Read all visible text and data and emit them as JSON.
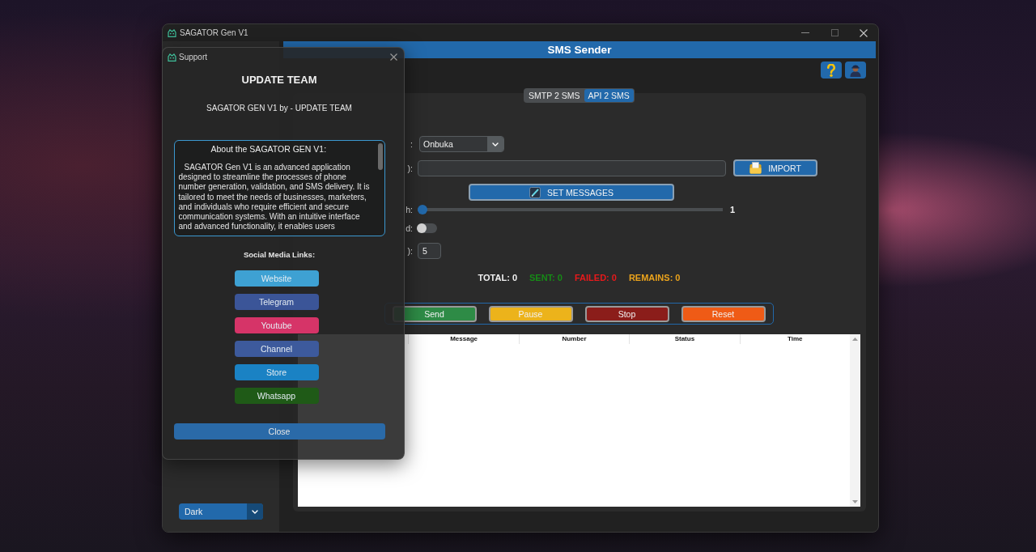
{
  "window": {
    "title": "SAGATOR Gen V1"
  },
  "sidebar": {
    "appearance_mode": {
      "value": "Dark"
    }
  },
  "header": {
    "title": "SMS Sender"
  },
  "tabs": [
    {
      "label": "SMTP 2 SMS",
      "selected": false
    },
    {
      "label": "API 2 SMS",
      "selected": true
    }
  ],
  "form": {
    "provider": {
      "label": ":",
      "value": "Onbuka"
    },
    "recipients": {
      "label": "):",
      "button": "IMPORT"
    },
    "set_messages_button": "SET MESSAGES",
    "batch": {
      "label": "h:",
      "level": 0,
      "reading": "1"
    },
    "thread": {
      "label": "d:",
      "on": false
    },
    "interval": {
      "label": "):",
      "value": "5"
    }
  },
  "stats": [
    {
      "label": "TOTAL: 0",
      "color": "#f0f0f0"
    },
    {
      "label": "SENT: 0",
      "color": "#168a16"
    },
    {
      "label": "FAILED: 0",
      "color": "#e8191b"
    },
    {
      "label": "REMAINS: 0",
      "color": "#eba31c"
    }
  ],
  "controls": [
    {
      "label": "Send",
      "color": "#2e8b46"
    },
    {
      "label": "Pause",
      "color": "#ecb31b"
    },
    {
      "label": "Stop",
      "color": "#8b1d1a"
    },
    {
      "label": "Reset",
      "color": "#ef5b16"
    }
  ],
  "table": {
    "columns": [
      "Message",
      "Number",
      "Status",
      "Time"
    ]
  },
  "dialog": {
    "title": "Support",
    "heading": "UPDATE TEAM",
    "subtitle": "SAGATOR GEN V1 by - UPDATE TEAM",
    "about": {
      "heading": "About the SAGATOR GEN V1:",
      "text": "SAGATOR Gen V1 is an advanced application designed to streamline the processes of phone number generation, validation, and SMS delivery. It is tailored to meet the needs of businesses, marketers, and individuals who require efficient and secure communication systems. With an intuitive interface and advanced functionality, it enables users"
    },
    "links_label": "Social Media Links:",
    "links": [
      {
        "label": "Website",
        "color": "#3ea1d3"
      },
      {
        "label": "Telegram",
        "color": "#3b5598"
      },
      {
        "label": "Youtube",
        "color": "#d63468"
      },
      {
        "label": "Channel",
        "color": "#3d5a9c"
      },
      {
        "label": "Store",
        "color": "#1a82c4"
      },
      {
        "label": "Whatsapp",
        "color": "#1f5a17"
      }
    ],
    "close_button": "Close"
  }
}
